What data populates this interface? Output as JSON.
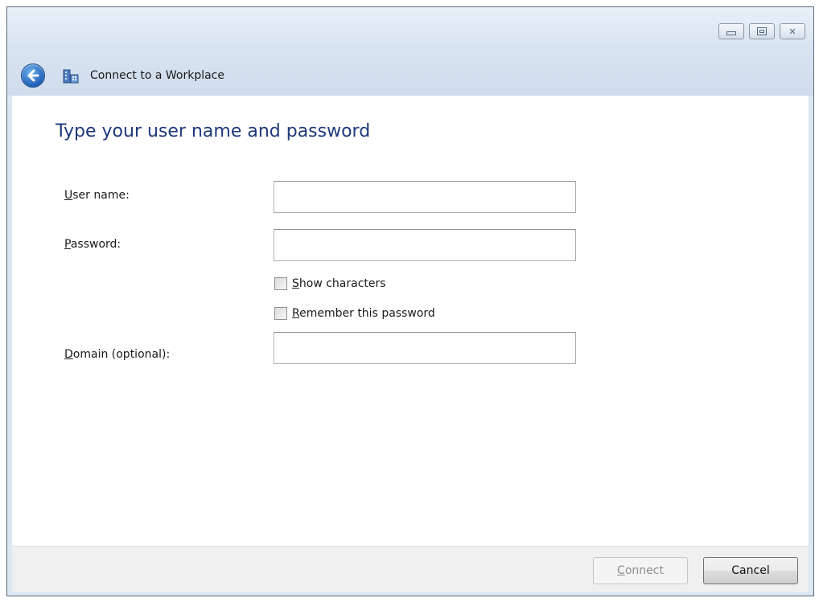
{
  "window": {
    "title": "Connect to a Workplace",
    "controls": {
      "minimize_icon": "minimize-icon",
      "maximize_icon": "maximize-icon",
      "close_icon": "close-icon"
    }
  },
  "page": {
    "heading": "Type your user name and password"
  },
  "form": {
    "username": {
      "label_accel": "U",
      "label_rest": "ser name:",
      "value": "",
      "placeholder": ""
    },
    "password": {
      "label_accel": "P",
      "label_rest": "assword:",
      "value": "",
      "placeholder": ""
    },
    "show_characters": {
      "label_accel": "S",
      "label_rest": "how characters",
      "checked": false
    },
    "remember_password": {
      "label_accel": "R",
      "label_rest": "emember this password",
      "checked": false
    },
    "domain": {
      "label_accel": "D",
      "label_rest": "omain (optional):",
      "value": "",
      "placeholder": ""
    }
  },
  "footer": {
    "connect": {
      "label_accel": "C",
      "label_rest": "onnect",
      "enabled": false
    },
    "cancel": {
      "label": "Cancel"
    }
  },
  "colors": {
    "heading": "#1e3a7b",
    "disabled_text": "#8d8d8d",
    "window_chrome": "#dce7f4"
  }
}
